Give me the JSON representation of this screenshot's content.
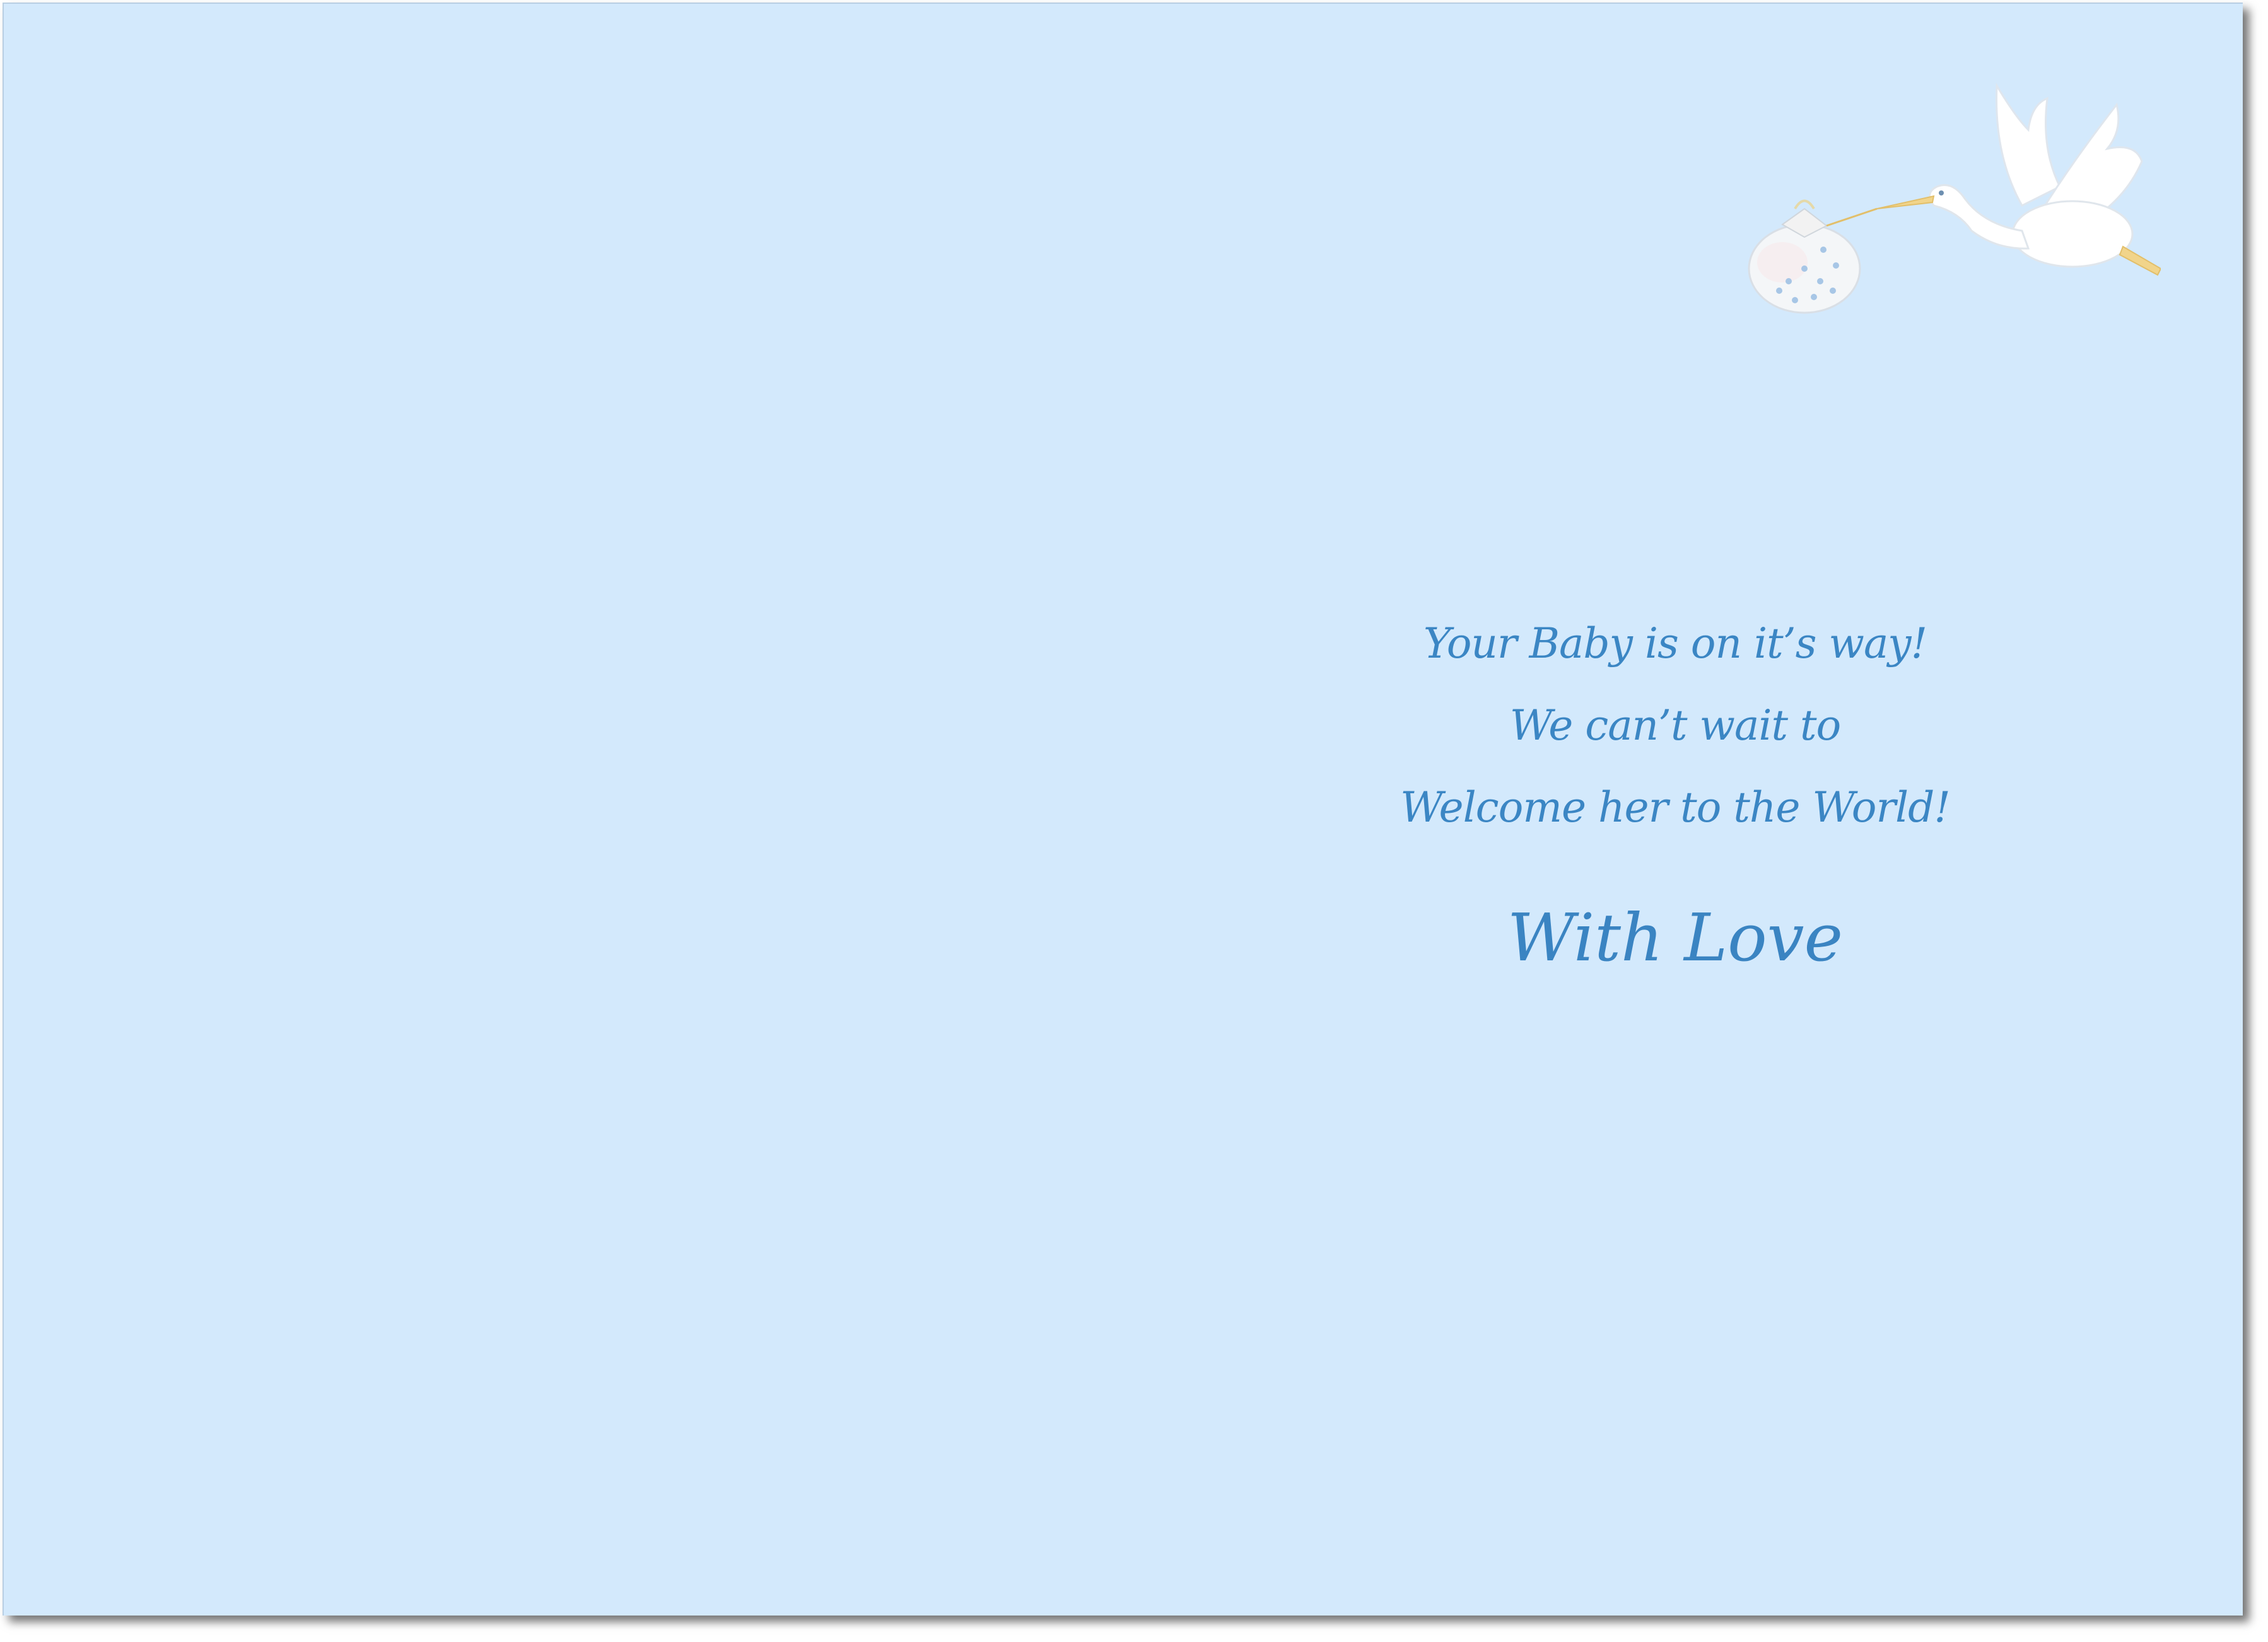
{
  "card": {
    "background_color": "#d3e9fc",
    "text_color": "#3b86c4",
    "illustration_icon": "stork-carrying-baby-bundle-icon"
  },
  "message": {
    "lines": [
      "Your Baby is on it’s way!",
      "We can’t wait to",
      "Welcome her to the World!"
    ],
    "signoff": "With Love"
  }
}
